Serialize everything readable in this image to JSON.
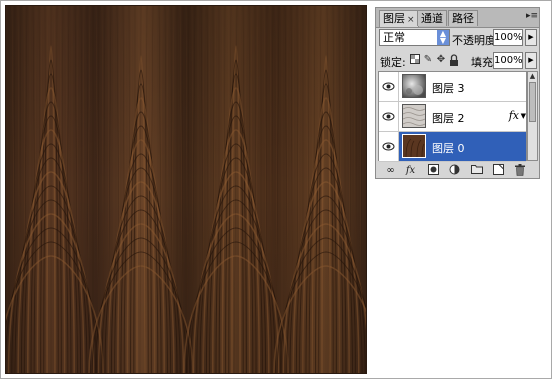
{
  "panel": {
    "tabs": [
      {
        "label": "图层",
        "close": "×",
        "active": true
      },
      {
        "label": "通道",
        "active": false
      },
      {
        "label": "路径",
        "active": false
      }
    ],
    "menu_icon": "panel-menu-icon",
    "blend_mode": "正常",
    "opacity_label": "不透明度:",
    "opacity_value": "100%",
    "lock_label": "锁定:",
    "fill_label": "填充:",
    "fill_value": "100%",
    "layers": [
      {
        "name": "图层 3",
        "visible": true,
        "selected": false,
        "thumb": "clouds-texture",
        "has_fx": false
      },
      {
        "name": "图层 2",
        "visible": true,
        "selected": false,
        "thumb": "light-pattern-texture",
        "has_fx": true,
        "fx_label": "fx"
      },
      {
        "name": "图层 0",
        "visible": true,
        "selected": true,
        "thumb": "wood-texture",
        "has_fx": false
      }
    ],
    "bottom_icons": [
      "link-icon",
      "fx-icon",
      "mask-icon",
      "adjustment-icon",
      "group-folder-icon",
      "new-layer-icon",
      "trash-icon"
    ]
  },
  "colors": {
    "selected_layer": "#3060b8",
    "panel_bg": "#d6d6d6",
    "wood_dark": "#3a2214",
    "wood_light": "#8a5a32"
  }
}
